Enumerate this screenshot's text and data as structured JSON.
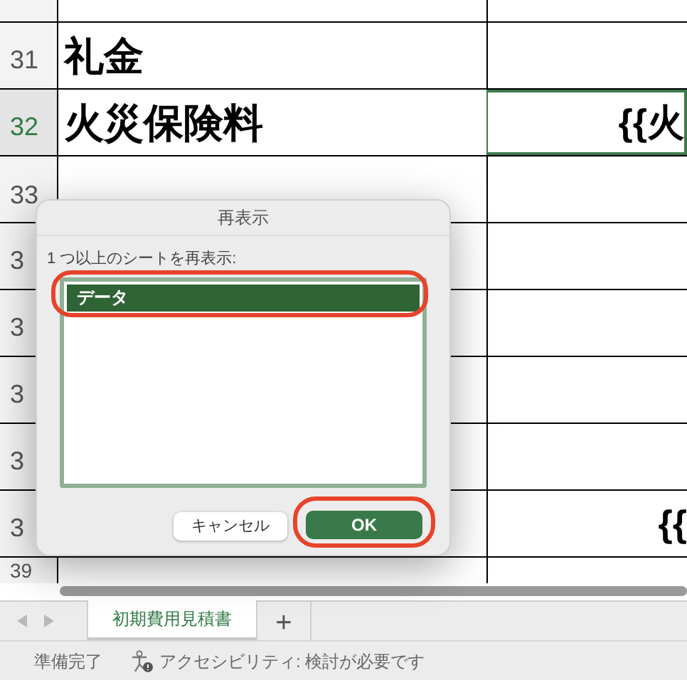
{
  "sheet": {
    "rows": [
      {
        "selected": false
      },
      {
        "number": "31",
        "column_a": "礼金",
        "selected": false
      },
      {
        "number": "32",
        "column_a": "火災保険料",
        "column_b": "{{火",
        "selected": true
      },
      {
        "number": "33",
        "selected": false
      },
      {
        "number": "3",
        "selected": false
      },
      {
        "number": "3",
        "selected": false
      },
      {
        "number": "3",
        "selected": false
      },
      {
        "number": "3",
        "selected": false
      },
      {
        "number": "3",
        "column_b": "{{",
        "selected": false
      },
      {
        "number": "39",
        "selected": false
      }
    ]
  },
  "dialog": {
    "title": "再表示",
    "label": "1 つ以上のシートを再表示:",
    "sheets": [
      {
        "name": "データ",
        "selected": true
      }
    ],
    "buttons": [
      {
        "label": "キャンセル",
        "kind": "secondary"
      },
      {
        "label": "OK",
        "kind": "primary"
      }
    ]
  },
  "sheet_tabs": [
    {
      "label": "初期費用見積書",
      "selected": true
    }
  ],
  "add_sheet": "+",
  "status_bar": {
    "status": "準備完了",
    "accessibility": "アクセシビリティ: 検討が必要です"
  }
}
